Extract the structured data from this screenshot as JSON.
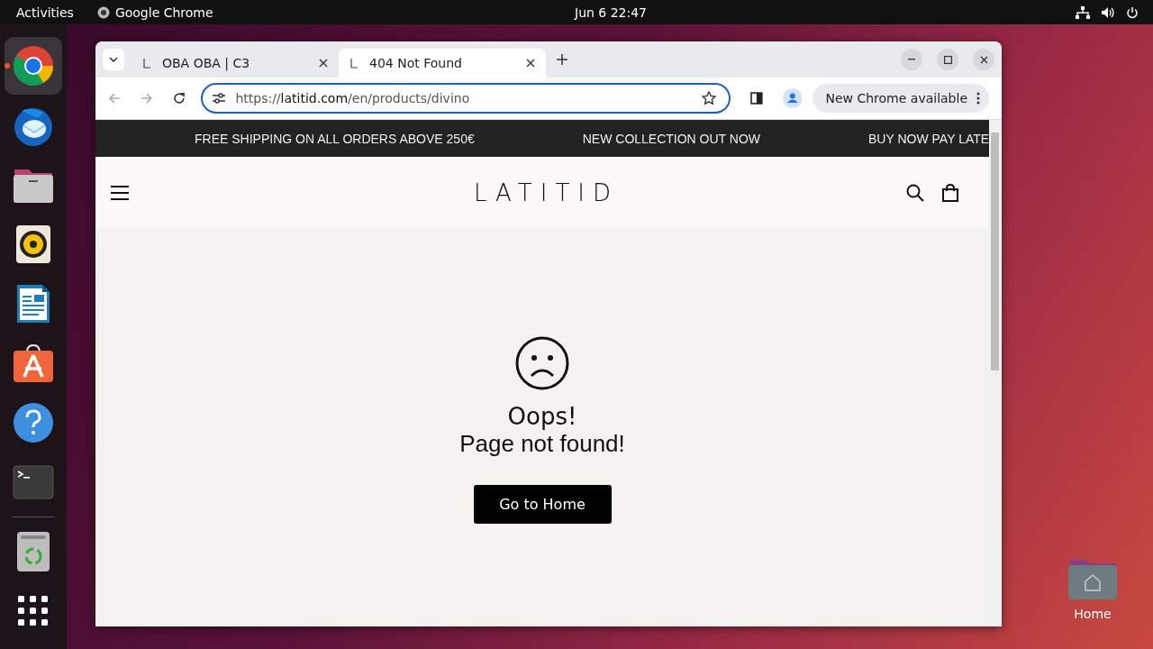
{
  "topbar": {
    "activities": "Activities",
    "app_name": "Google Chrome",
    "clock": "Jun 6  22:47"
  },
  "dock": {
    "items": [
      {
        "kind": "chrome",
        "running": true
      },
      {
        "kind": "mail",
        "running": false
      },
      {
        "kind": "files",
        "running": false
      },
      {
        "kind": "music",
        "running": false
      },
      {
        "kind": "writer",
        "running": false
      },
      {
        "kind": "store",
        "running": false
      },
      {
        "kind": "help",
        "running": false
      },
      {
        "kind": "terminal",
        "running": false
      },
      {
        "kind": "trash",
        "running": false
      },
      {
        "kind": "apps",
        "running": false
      }
    ]
  },
  "browser": {
    "tabs": [
      {
        "title": "OBA OBA | C3",
        "selected": false
      },
      {
        "title": "404 Not Found",
        "selected": true
      }
    ],
    "url": {
      "scheme": "https://",
      "host": "latitid.com",
      "path": "/en/products/divino"
    },
    "update_button": "New Chrome available"
  },
  "page": {
    "announcements": [
      "FREE SHIPPING ON ALL ORDERS ABOVE 250€",
      "NEW COLLECTION OUT NOW",
      "BUY NOW PAY LATE"
    ],
    "logo": "LATITID",
    "heading": "Oops!",
    "message": "Page not found!",
    "home_button": "Go to Home"
  },
  "desktop": {
    "home_label": "Home"
  }
}
